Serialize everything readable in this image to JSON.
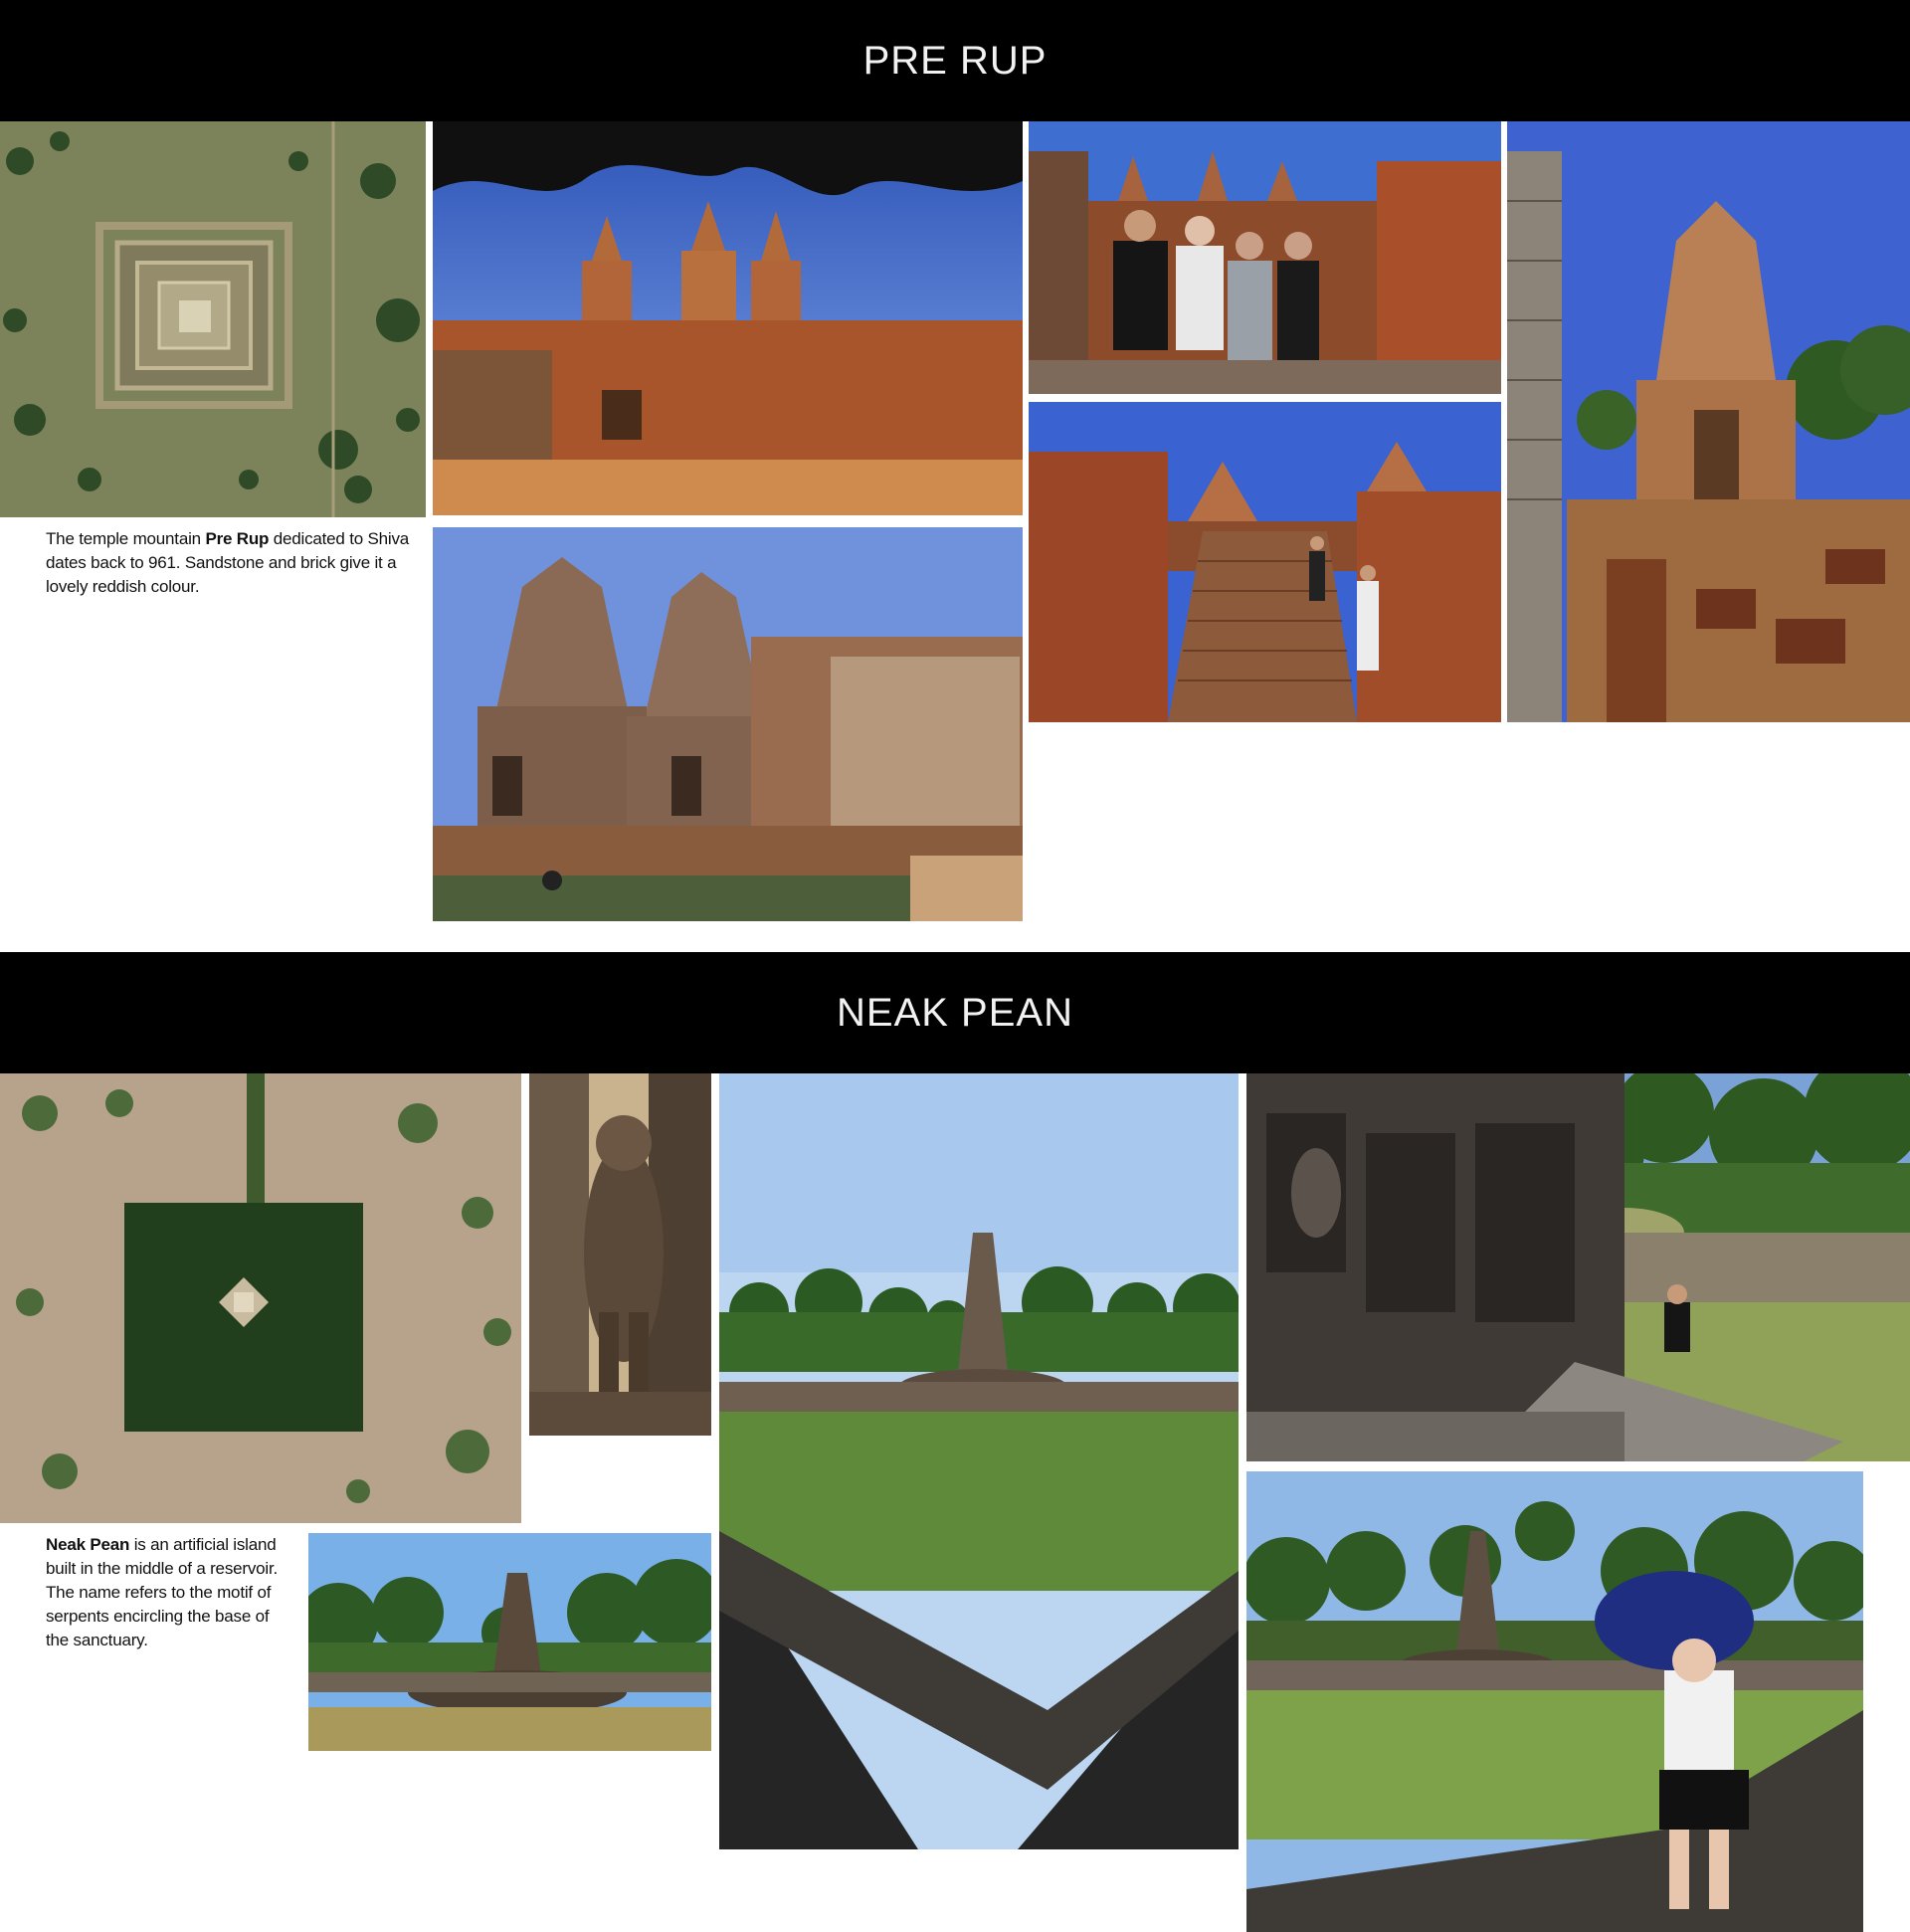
{
  "sections": {
    "pre_rup": {
      "title": "PRE RUP",
      "caption": {
        "pre": "The temple mountain ",
        "bold": "Pre Rup",
        "post": " dedicated to Shiva dates back to 961. Sandstone  and brick give it a lovely reddish colour."
      }
    },
    "neak_pean": {
      "title": "NEAK PEAN",
      "caption": {
        "pre": "",
        "bold": "Neak Pean",
        "post": " is an artificial island built in the middle of a reservoir. The name refers to  the motif of serpents encircling the base of the sanctuary."
      }
    }
  }
}
